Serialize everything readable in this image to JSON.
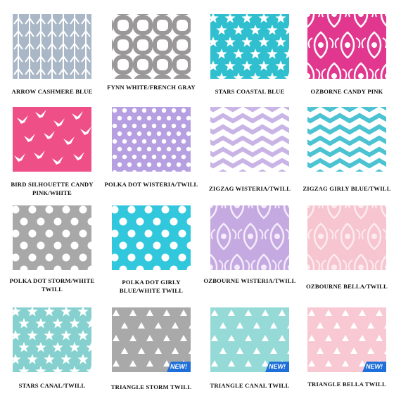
{
  "swatches": [
    {
      "label": "ARROW CASHMERE BLUE",
      "pattern": "arrows",
      "bg": "#a9b7c6",
      "fg": "#ffffff",
      "badge": ""
    },
    {
      "label": "FYNN WHITE/FRENCH GRAY",
      "pattern": "quatrefoil",
      "bg": "#ffffff",
      "fg": "#9a9898",
      "badge": ""
    },
    {
      "label": "STARS COASTAL BLUE",
      "pattern": "stars",
      "bg": "#2fbfcf",
      "fg": "#ffffff",
      "badge": ""
    },
    {
      "label": "OZBORNE CANDY PINK",
      "pattern": "damask",
      "bg": "#e2378f",
      "fg": "#ffffff",
      "badge": ""
    },
    {
      "label": "BIRD SILHOUETTE CANDY PINK/WHITE",
      "pattern": "birds",
      "bg": "#ee4f86",
      "fg": "#ffffff",
      "badge": ""
    },
    {
      "label": "POLKA DOT WISTERIA/TWILL",
      "pattern": "dots",
      "bg": "#b7a0e2",
      "fg": "#ffffff",
      "badge": ""
    },
    {
      "label": "ZIGZAG WISTERIA/TWILL",
      "pattern": "zigzag",
      "bg": "#ffffff",
      "fg": "#c9b4e6",
      "badge": ""
    },
    {
      "label": "ZIGZAG GIRLY BLUE/TWILL",
      "pattern": "zigzag",
      "bg": "#ffffff",
      "fg": "#4cc3d2",
      "badge": ""
    },
    {
      "label": "POLKA DOT STORM/WHITE TWILL",
      "pattern": "bigdots",
      "bg": "#a8a8a8",
      "fg": "#ffffff",
      "badge": ""
    },
    {
      "label": "POLKA DOT GIRLY BLUE/WHITE TWILL",
      "pattern": "bigdots",
      "bg": "#31c7dc",
      "fg": "#ffffff",
      "badge": ""
    },
    {
      "label": "OZBOURNE WISTERIA/TWILL",
      "pattern": "damask",
      "bg": "#c5a9e1",
      "fg": "#f4ecfb",
      "badge": ""
    },
    {
      "label": "OZBOURNE BELLA/TWILL",
      "pattern": "damask",
      "bg": "#f6c5cf",
      "fg": "#fcebef",
      "badge": ""
    },
    {
      "label": "STARS CANAL/TWILL",
      "pattern": "stars",
      "bg": "#86d1cf",
      "fg": "#ffffff",
      "badge": ""
    },
    {
      "label": "TRIANGLE STORM TWILL",
      "pattern": "triangles",
      "bg": "#a9a9a9",
      "fg": "#ffffff",
      "badge": "NEW!"
    },
    {
      "label": "TRIANGLE CANAL TWILL",
      "pattern": "triangles",
      "bg": "#96dad8",
      "fg": "#ffffff",
      "badge": "NEW!"
    },
    {
      "label": "TRIANGLE BELLA TWILL",
      "pattern": "triangles",
      "bg": "#f9c9d3",
      "fg": "#ffffff",
      "badge": "NEW!"
    }
  ]
}
